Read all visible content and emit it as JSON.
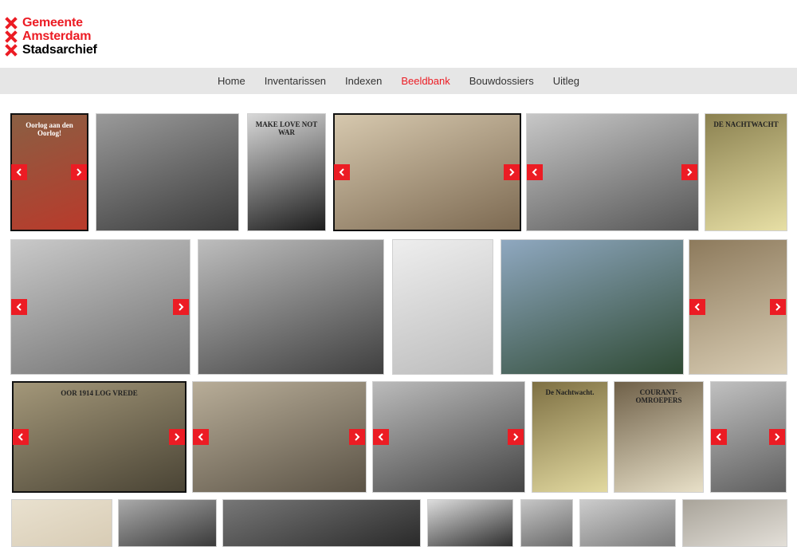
{
  "logo": {
    "line1": "Gemeente",
    "line2": "Amsterdam",
    "line3": "Stadsarchief"
  },
  "nav": {
    "items": [
      "Home",
      "Inventarissen",
      "Indexen",
      "Beeldbank",
      "Bouwdossiers",
      "Uitleg"
    ],
    "active": "Beeldbank"
  },
  "images": [
    {
      "caption": "Oorlog aan den Oorlog!",
      "colors": [
        "#b93a2b",
        "#8a5f43"
      ]
    },
    {
      "caption": "",
      "colors": [
        "#3b3b3b",
        "#9a9a9a"
      ]
    },
    {
      "caption": "MAKE LOVE NOT WAR",
      "colors": [
        "#1d1d1d",
        "#d8d8d8"
      ]
    },
    {
      "caption": "",
      "colors": [
        "#7d6a52",
        "#d6c8ae"
      ]
    },
    {
      "caption": "",
      "colors": [
        "#565656",
        "#c7c7c7"
      ]
    },
    {
      "caption": "DE NACHTWACHT",
      "colors": [
        "#e7dfa5",
        "#8b8150"
      ]
    },
    {
      "caption": "",
      "colors": [
        "#6f6f6f",
        "#c9c9c9"
      ]
    },
    {
      "caption": "",
      "colors": [
        "#3f3f3f",
        "#bdbdbd"
      ]
    },
    {
      "caption": "",
      "colors": [
        "#bcbcbc",
        "#eeeeee"
      ]
    },
    {
      "caption": "",
      "colors": [
        "#2f4a34",
        "#8fa8c0"
      ]
    },
    {
      "caption": "",
      "colors": [
        "#d9cdb4",
        "#8d7a5c"
      ]
    },
    {
      "caption": "OOR 1914 LOG VREDE",
      "colors": [
        "#4a4435",
        "#a39779"
      ]
    },
    {
      "caption": "",
      "colors": [
        "#5b5346",
        "#b8ad98"
      ]
    },
    {
      "caption": "",
      "colors": [
        "#444444",
        "#bbbbbb"
      ]
    },
    {
      "caption": "De Nachtwacht.",
      "colors": [
        "#e2d9a0",
        "#7e7043"
      ]
    },
    {
      "caption": "COURANT-OMROEPERS",
      "colors": [
        "#e8e0c8",
        "#6f6048"
      ]
    },
    {
      "caption": "",
      "colors": [
        "#5f5f5f",
        "#c0c0c0"
      ]
    },
    {
      "caption": "",
      "colors": [
        "#d8ccb5",
        "#e9e1cf"
      ]
    },
    {
      "caption": "",
      "colors": [
        "#3a3a3a",
        "#aaaaaa"
      ]
    },
    {
      "caption": "",
      "colors": [
        "#2a2a2a",
        "#777777"
      ]
    },
    {
      "caption": "",
      "colors": [
        "#2d2d2d",
        "#dddddd"
      ]
    },
    {
      "caption": "",
      "colors": [
        "#6a6a6a",
        "#c6c6c6"
      ]
    },
    {
      "caption": "",
      "colors": [
        "#7a7a7a",
        "#cccccc"
      ]
    },
    {
      "caption": "",
      "colors": [
        "#e3dfd8",
        "#a9a49a"
      ]
    }
  ],
  "accent": "#ec1c24"
}
